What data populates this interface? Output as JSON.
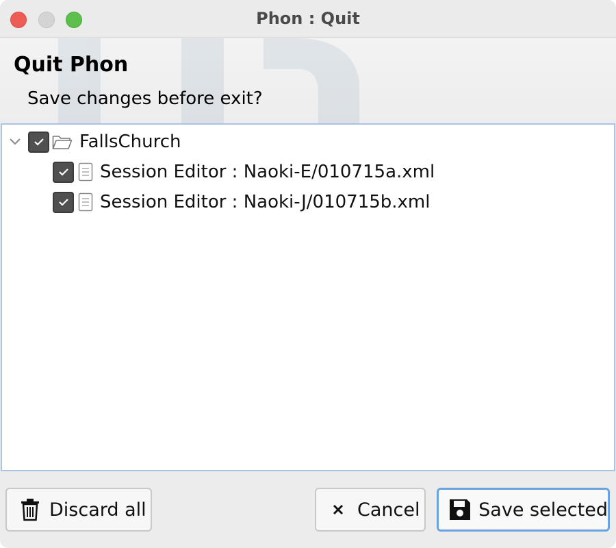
{
  "window": {
    "title": "Phon : Quit"
  },
  "header": {
    "title": "Quit Phon",
    "subtitle": "Save changes before exit?"
  },
  "tree": {
    "root": {
      "label": "FallsChurch",
      "checked": true,
      "expanded": true,
      "icon": "folder-open-icon"
    },
    "children": [
      {
        "label": "Session Editor : Naoki-E/010715a.xml",
        "checked": true,
        "icon": "document-icon"
      },
      {
        "label": "Session Editor : Naoki-J/010715b.xml",
        "checked": true,
        "icon": "document-icon"
      }
    ]
  },
  "buttons": {
    "discard_label": "Discard all",
    "cancel_label": "Cancel",
    "save_label": "Save selected"
  },
  "colors": {
    "focus_border": "#6aa3e0",
    "close": "#ee5d55",
    "minimize": "#d4d4d4",
    "maximize": "#5ec04c"
  }
}
